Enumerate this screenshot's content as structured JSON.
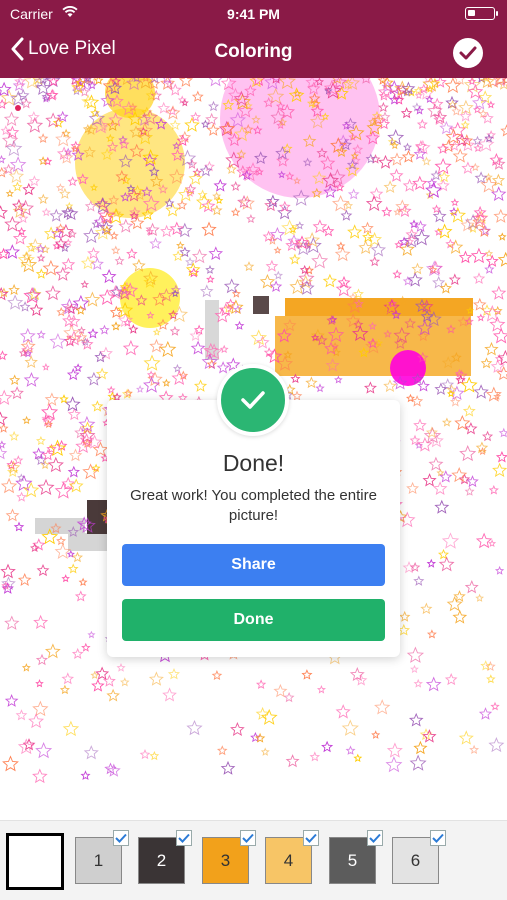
{
  "status_bar": {
    "carrier": "Carrier",
    "time": "9:41 PM"
  },
  "navbar": {
    "back_label": "Love Pixel",
    "title": "Coloring"
  },
  "dialog": {
    "title": "Done!",
    "message": "Great work! You completed the entire picture!",
    "share_label": "Share",
    "done_label": "Done"
  },
  "palette": {
    "selected_color": "#ffffff",
    "swatches": [
      {
        "label": "1",
        "color": "#cfcfcf",
        "text_color": "#333333",
        "completed": true
      },
      {
        "label": "2",
        "color": "#3a3435",
        "text_color": "#ffffff",
        "completed": true
      },
      {
        "label": "3",
        "color": "#f2a11b",
        "text_color": "#333333",
        "completed": true
      },
      {
        "label": "4",
        "color": "#f7c566",
        "text_color": "#333333",
        "completed": true
      },
      {
        "label": "5",
        "color": "#5c5c5c",
        "text_color": "#ffffff",
        "completed": true
      },
      {
        "label": "6",
        "color": "#e3e3e3",
        "text_color": "#333333",
        "completed": true
      }
    ]
  },
  "colors": {
    "brand": "#8a1a47",
    "success": "#2bb673",
    "share": "#3c7ff1",
    "done": "#20b16a"
  }
}
